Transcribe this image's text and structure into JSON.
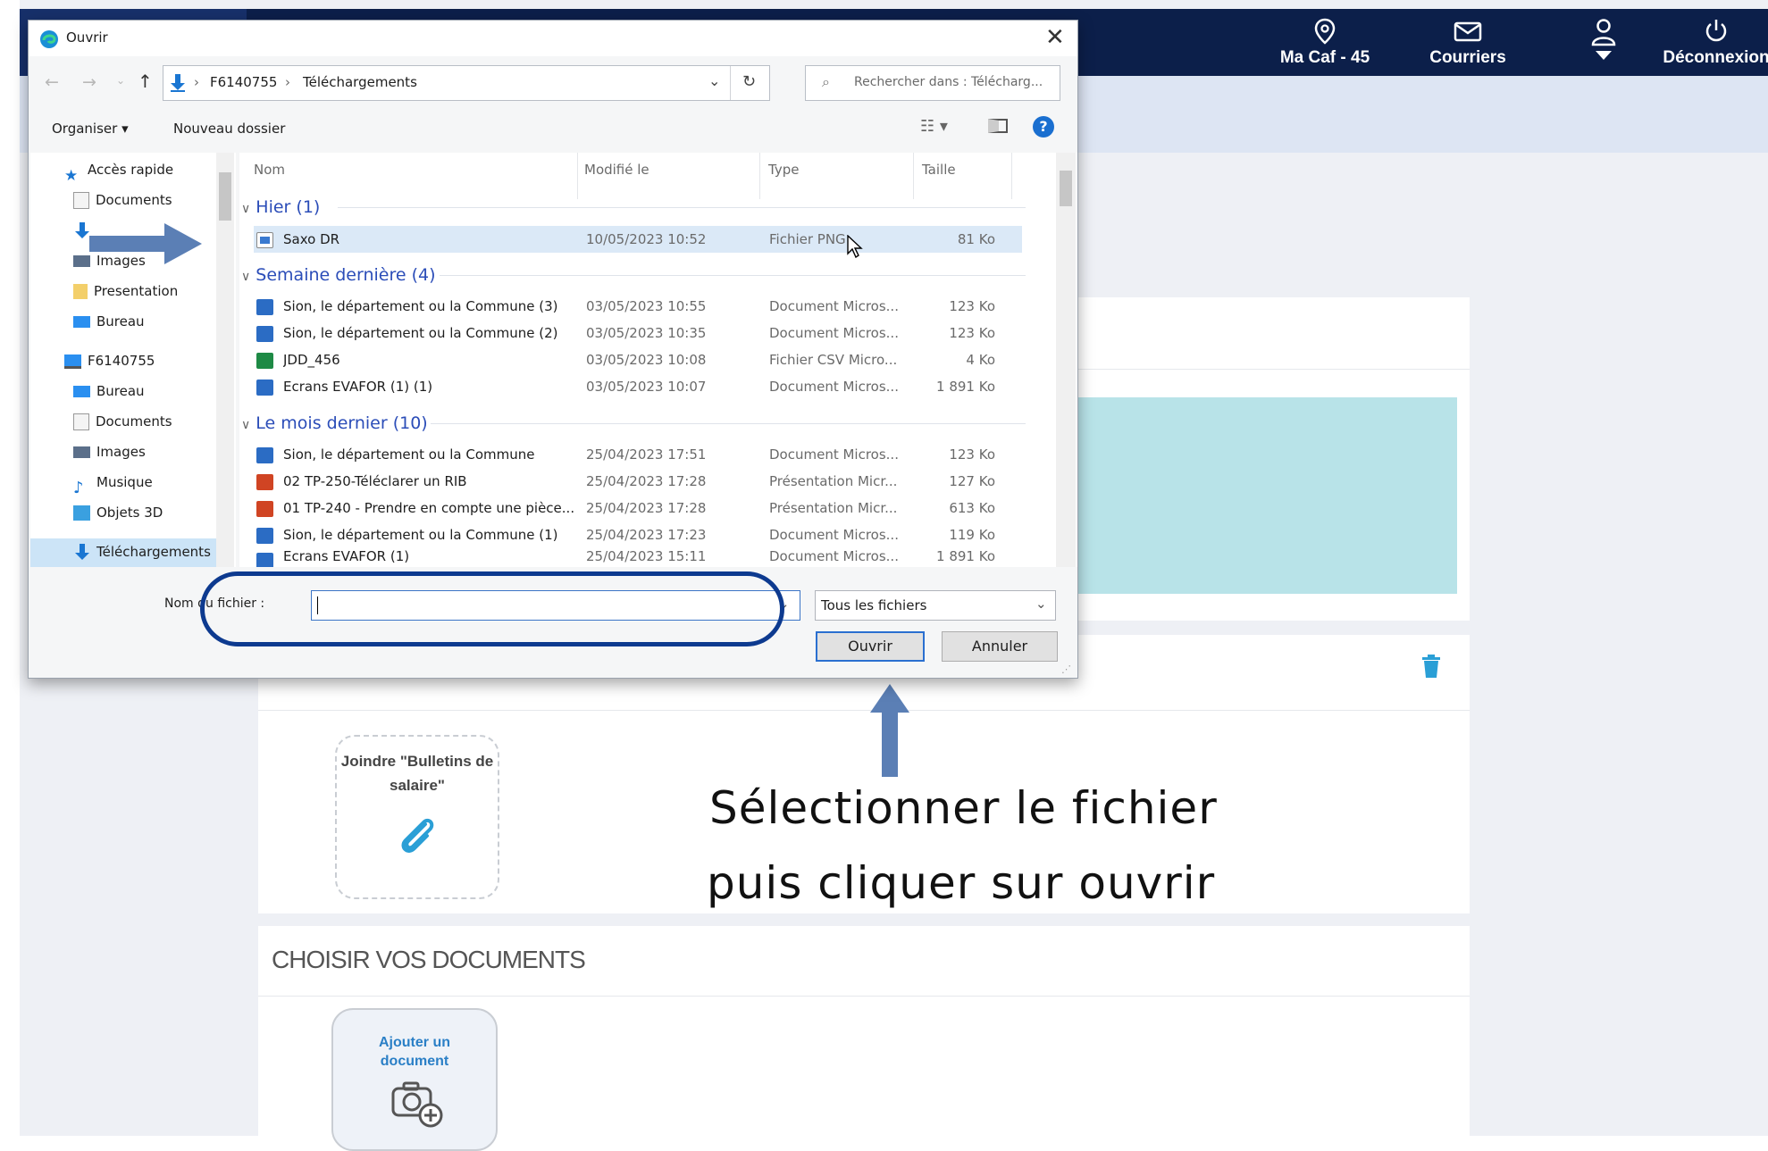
{
  "topbar": {
    "items": [
      {
        "label": "Ma Caf - 45",
        "icon": "location-pin-icon"
      },
      {
        "label": "Courriers",
        "icon": "mail-icon"
      },
      {
        "label": "",
        "icon": "user-icon"
      },
      {
        "label": "Déconnexion",
        "icon": "power-icon"
      }
    ]
  },
  "page": {
    "upload_card_label": "Joindre \"Bulletins de salaire\"",
    "choose_section_title": "CHOISIR VOS DOCUMENTS",
    "add_document_label": "Ajouter un document"
  },
  "dialog": {
    "title": "Ouvrir",
    "breadcrumb": [
      "F6140755",
      "Téléchargements"
    ],
    "search_placeholder": "Rechercher dans : Télécharg...",
    "toolbar": {
      "organize": "Organiser ▾",
      "new_folder": "Nouveau dossier"
    },
    "nav": [
      {
        "label": "Accès rapide",
        "icon": "star-icon"
      },
      {
        "label": "Documents",
        "icon": "document-folder-icon"
      },
      {
        "label": "",
        "icon": "download-icon"
      },
      {
        "label": "Images",
        "icon": "images-folder-icon"
      },
      {
        "label": "Presentation",
        "icon": "folder-icon"
      },
      {
        "label": "Bureau",
        "icon": "desktop-folder-icon"
      },
      {
        "label": "F6140755",
        "icon": "computer-icon"
      },
      {
        "label": "Bureau",
        "icon": "desktop-folder-icon"
      },
      {
        "label": "Documents",
        "icon": "document-folder-icon"
      },
      {
        "label": "Images",
        "icon": "images-folder-icon"
      },
      {
        "label": "Musique",
        "icon": "music-icon"
      },
      {
        "label": "Objets 3D",
        "icon": "cube-icon"
      },
      {
        "label": "Téléchargements",
        "icon": "download-icon"
      }
    ],
    "columns": {
      "name": "Nom",
      "modified": "Modifié le",
      "type": "Type",
      "size": "Taille"
    },
    "groups": [
      {
        "label": "Hier (1)",
        "files": [
          {
            "name": "Saxo DR",
            "modified": "10/05/2023 10:52",
            "type": "Fichier PNG",
            "size": "81 Ko",
            "kind": "image"
          }
        ]
      },
      {
        "label": "Semaine dernière (4)",
        "files": [
          {
            "name": "Sion, le département ou la Commune (3)",
            "modified": "03/05/2023 10:55",
            "type": "Document Micros...",
            "size": "123 Ko",
            "kind": "word"
          },
          {
            "name": "Sion, le département ou la Commune (2)",
            "modified": "03/05/2023 10:35",
            "type": "Document Micros...",
            "size": "123 Ko",
            "kind": "word"
          },
          {
            "name": "JDD_456",
            "modified": "03/05/2023 10:08",
            "type": "Fichier CSV Micro...",
            "size": "4 Ko",
            "kind": "excel"
          },
          {
            "name": "Ecrans EVAFOR (1) (1)",
            "modified": "03/05/2023 10:07",
            "type": "Document Micros...",
            "size": "1 891 Ko",
            "kind": "word"
          }
        ]
      },
      {
        "label": "Le mois dernier (10)",
        "files": [
          {
            "name": "Sion, le département ou la Commune",
            "modified": "25/04/2023 17:51",
            "type": "Document Micros...",
            "size": "123 Ko",
            "kind": "word"
          },
          {
            "name": "02 TP-250-Téléclarer un RIB",
            "modified": "25/04/2023 17:28",
            "type": "Présentation Micr...",
            "size": "127 Ko",
            "kind": "ppt"
          },
          {
            "name": "01 TP-240 - Prendre en compte une pièce...",
            "modified": "25/04/2023 17:28",
            "type": "Présentation Micr...",
            "size": "613 Ko",
            "kind": "ppt"
          },
          {
            "name": "Sion, le département ou la Commune (1)",
            "modified": "25/04/2023 17:23",
            "type": "Document Micros...",
            "size": "119 Ko",
            "kind": "word"
          },
          {
            "name": "Ecrans EVAFOR (1)",
            "modified": "25/04/2023 15:11",
            "type": "Document Micros...",
            "size": "1 891 Ko",
            "kind": "word"
          }
        ]
      }
    ],
    "filename_label": "Nom du fichier :",
    "filename_value": "",
    "filter_value": "Tous les fichiers",
    "open_button": "Ouvrir",
    "cancel_button": "Annuler"
  },
  "annotation": {
    "line1": "Sélectionner le fichier",
    "line2": "puis cliquer sur ouvrir",
    "arrow_color": "#5b7fb5",
    "highlight_color": "#0d3a8f"
  },
  "colors": {
    "topbar": "#0c1f4a",
    "accent_blue": "#2b4db8",
    "teal_panel": "#b8e3e8",
    "selected_row": "#dbe9f7"
  }
}
